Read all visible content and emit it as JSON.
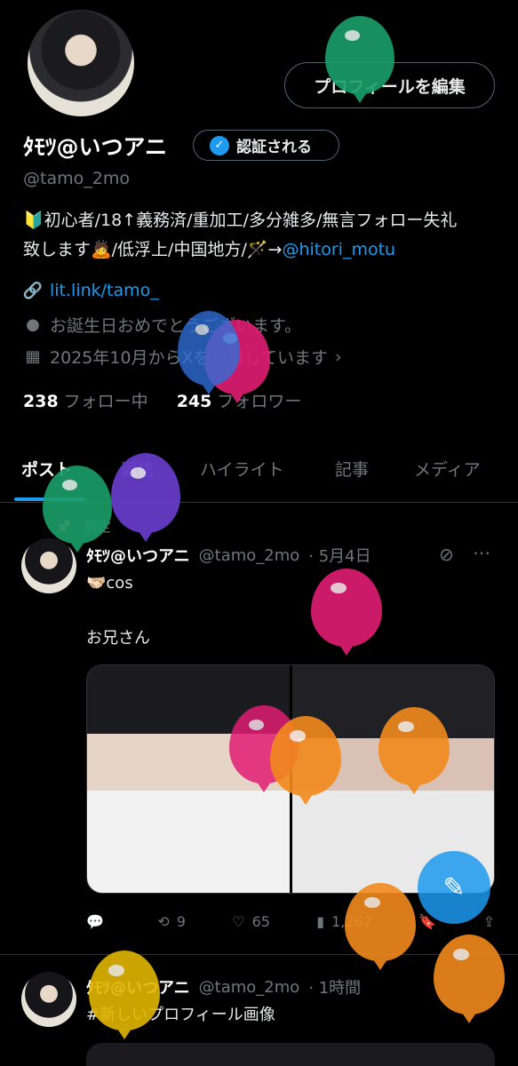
{
  "profile": {
    "edit_label": "プロフィールを編集",
    "name": "ﾀﾓﾂ@いつアニ",
    "verify_label": "認証される",
    "handle": "@tamo_2mo",
    "bio_line1": "🔰初心者/18↑義務済/重加工/多分雑多/無言フォロー失礼",
    "bio_line2_prefix": "致します🙇/低浮上/中国地方/🪄→",
    "bio_link": "@hitori_motu",
    "website": "lit.link/tamo_",
    "birthday": "お誕生日おめでとうございます。",
    "joined": "2025年10月からXを利用しています",
    "following_count": "238",
    "following_label": "フォロー中",
    "followers_count": "245",
    "followers_label": "フォロワー"
  },
  "tabs": [
    "ポスト",
    "返信",
    "ハイライト",
    "記事",
    "メディア"
  ],
  "posts": [
    {
      "pinned_label": "固定",
      "name": "ﾀﾓﾂ@いつアニ",
      "handle": "@tamo_2mo",
      "date": "· 5月4日",
      "line1": "🫱🏻‍🫲🏼cos",
      "line2": "お兄さん",
      "replies": "",
      "reposts": "9",
      "likes": "65",
      "views": "1,267"
    },
    {
      "name": "ﾀﾓﾂ@いつアニ",
      "handle": "@tamo_2mo",
      "date": "· 1時間",
      "hashtag": "#新しいプロフィール画像"
    }
  ],
  "colors": {
    "accent": "#1d9bf0",
    "balloons": [
      "#1a9f6a",
      "#e11d74",
      "#2f6fd6",
      "#6a3fd0",
      "#f28a1d",
      "#e3b600"
    ]
  }
}
